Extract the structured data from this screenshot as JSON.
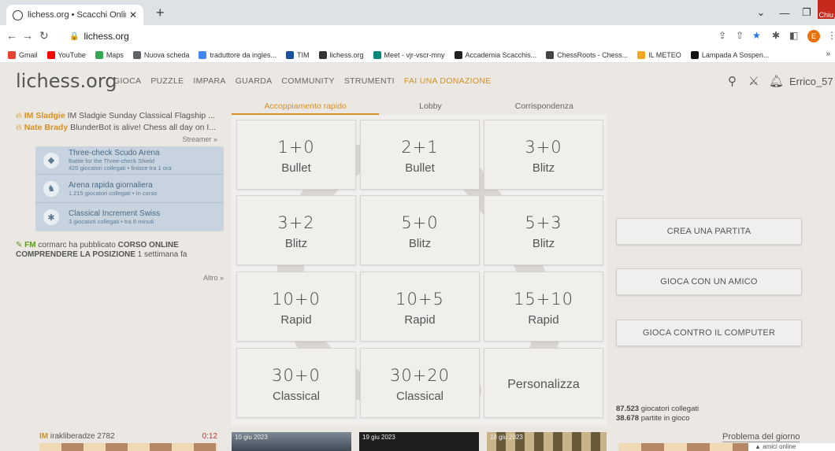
{
  "browser": {
    "tab_title": "lichess.org • Scacchi Online Gratis",
    "new_tab": "+",
    "url": "lichess.org",
    "close_tooltip": "Chiu",
    "profile_initial": "E",
    "bookmarks": [
      {
        "label": "Gmail",
        "color": "#ea4335"
      },
      {
        "label": "YouTube",
        "color": "#ff0000"
      },
      {
        "label": "Maps",
        "color": "#34a853"
      },
      {
        "label": "Nuova scheda",
        "color": "#5f6368"
      },
      {
        "label": "traduttore da ingles...",
        "color": "#4285f4"
      },
      {
        "label": "TIM",
        "color": "#1a4fa0"
      },
      {
        "label": "lichess.org",
        "color": "#333333"
      },
      {
        "label": "Meet - vjr-vscr-mny",
        "color": "#00897b"
      },
      {
        "label": "Accademia Scacchis...",
        "color": "#222222"
      },
      {
        "label": "ChessRoots - Chess...",
        "color": "#444444"
      },
      {
        "label": "IL METEO",
        "color": "#f5a623"
      },
      {
        "label": "Lampada A Sospen...",
        "color": "#111111"
      }
    ],
    "bookmarks_more": "»"
  },
  "header": {
    "logo": "lichess.org",
    "nav": [
      "GIOCA",
      "PUZZLE",
      "IMPARA",
      "GUARDA",
      "COMMUNITY",
      "STRUMENTI"
    ],
    "donate": "FAI UNA DONAZIONE",
    "username": "Errico_57"
  },
  "left": {
    "streams": [
      {
        "title": "IM",
        "name": "Sladgie",
        "text": " IM Sladgie Sunday Classical Flagship ..."
      },
      {
        "title": "",
        "name": "Nate Brady",
        "text": " BlunderBot is alive! Chess all day on I..."
      }
    ],
    "streamer_link": "Streamer »",
    "events": [
      {
        "icon": "shield-icon",
        "glyph": "◆",
        "title": "Three-check Scudo Arena",
        "lines": [
          "Battle for the Three-check Shield",
          "420 giocatori collegati • finisce tra 1 ora"
        ]
      },
      {
        "icon": "rabbit-icon",
        "glyph": "♞",
        "title": "Arena rapida giornaliera",
        "lines": [
          "1.215 giocatori collegati • In corso"
        ]
      },
      {
        "icon": "swiss-icon",
        "glyph": "✱",
        "title": "Classical Increment Swiss",
        "lines": [
          "3 giocatori collegati • tra 8 minuti"
        ]
      }
    ],
    "post": {
      "title": "FM",
      "author": "cormarc",
      "text": " ha pubblicato ",
      "subject": "CORSO ONLINE COMPRENDERE LA POSIZIONE",
      "when": " 1 settimana fa"
    },
    "more": "Altro »"
  },
  "tabs": [
    "Accoppiamento rapido",
    "Lobby",
    "Corrispondenza"
  ],
  "pool": [
    {
      "clock": "1+0",
      "perf": "Bullet"
    },
    {
      "clock": "2+1",
      "perf": "Bullet"
    },
    {
      "clock": "3+0",
      "perf": "Blitz"
    },
    {
      "clock": "3+2",
      "perf": "Blitz"
    },
    {
      "clock": "5+0",
      "perf": "Blitz"
    },
    {
      "clock": "5+3",
      "perf": "Blitz"
    },
    {
      "clock": "10+0",
      "perf": "Rapid"
    },
    {
      "clock": "10+5",
      "perf": "Rapid"
    },
    {
      "clock": "15+10",
      "perf": "Rapid"
    },
    {
      "clock": "30+0",
      "perf": "Classical"
    },
    {
      "clock": "30+20",
      "perf": "Classical"
    },
    {
      "clock": "",
      "perf": "Personalizza"
    }
  ],
  "actions": [
    "CREA UNA PARTITA",
    "GIOCA CON UN AMICO",
    "GIOCA CONTRO IL COMPUTER"
  ],
  "counts": {
    "players": "87.523",
    "players_label": " giocatori collegati",
    "games": "38.678",
    "games_label": " partite in gioco"
  },
  "bottom": {
    "player_title": "IM",
    "player_name": " irakliberadze 2782",
    "player_time": "0:12",
    "blogs": [
      {
        "date": "10 giu 2023"
      },
      {
        "date": "19 giu 2023"
      },
      {
        "date": "18 giu 2023"
      }
    ],
    "puzzle": "Problema del giorno",
    "friends": "▲ amici online"
  }
}
